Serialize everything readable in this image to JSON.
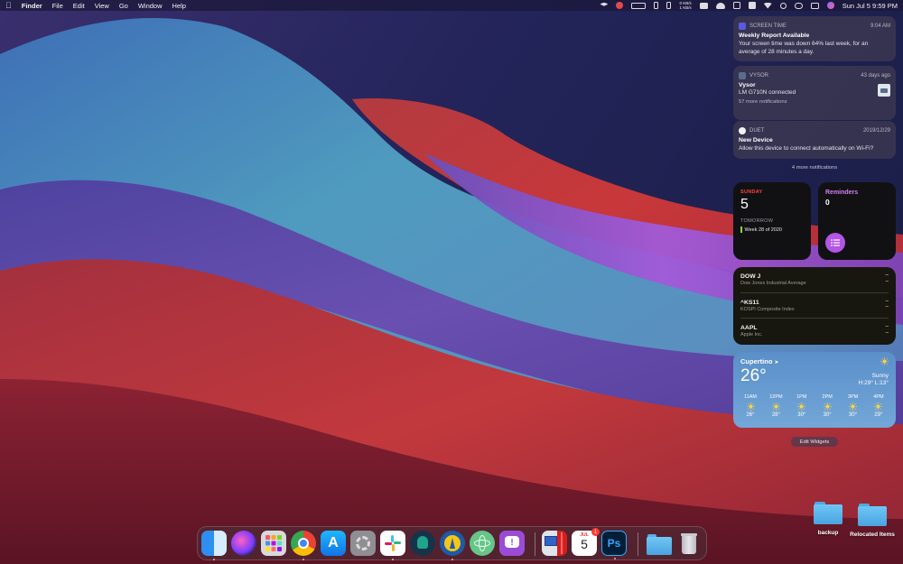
{
  "menubar": {
    "app_name": "Finder",
    "menus": [
      "File",
      "Edit",
      "View",
      "Go",
      "Window",
      "Help"
    ],
    "net_up": "0 KB/s",
    "net_down": "1 KB/s",
    "clock": "Sun Jul 5  9:59 PM",
    "status_icons": [
      "dropbox-icon",
      "avira-icon",
      "display-icon",
      "battery-icon",
      "memory-icon",
      "network-monitor-icon",
      "screen-mirror-icon",
      "cloud-icon",
      "vpn-icon",
      "keyboard-input-icon",
      "wifi-icon",
      "search-icon",
      "wechat-icon",
      "control-center-icon",
      "siri-icon"
    ]
  },
  "notifications": [
    {
      "app": "SCREEN TIME",
      "time": "9:04 AM",
      "title": "Weekly Report Available",
      "body": "Your screen time was down 64% last week, for an average of 28 minutes a day.",
      "icon_color": "#5a5adf"
    },
    {
      "app": "VYSOR",
      "time": "43 days ago",
      "title": "Vysor",
      "body": "LM G710N connected",
      "more": "57 more notifications",
      "icon_color": "#5a6e8c"
    },
    {
      "app": "DUET",
      "time": "2019/12/29",
      "title": "New Device",
      "body": "Allow this device to connect automatically on Wi-Fi?",
      "icon_color": "#f2f2f2"
    }
  ],
  "more_notifications": "4 more notifications",
  "calendar_widget": {
    "weekday": "SUNDAY",
    "date": "5",
    "tomorrow_label": "TOMORROW",
    "event": "Week 28 of 2020"
  },
  "reminders_widget": {
    "title": "Reminders",
    "count": "0"
  },
  "stocks_widget": {
    "rows": [
      {
        "symbol": "DOW J",
        "name": "Dow Jones Industrial Average",
        "value": "–",
        "change": "–"
      },
      {
        "symbol": "^KS11",
        "name": "KOSPI Composite Index",
        "value": "–",
        "change": "–"
      },
      {
        "symbol": "AAPL",
        "name": "Apple Inc.",
        "value": "–",
        "change": "–"
      }
    ]
  },
  "weather_widget": {
    "city": "Cupertino",
    "temp": "26°",
    "condition": "Sunny",
    "hilo": "H:29° L:13°",
    "hours": [
      {
        "time": "11AM",
        "temp": "26°"
      },
      {
        "time": "12PM",
        "temp": "28°"
      },
      {
        "time": "1PM",
        "temp": "30°"
      },
      {
        "time": "2PM",
        "temp": "30°"
      },
      {
        "time": "3PM",
        "temp": "30°"
      },
      {
        "time": "4PM",
        "temp": "29°"
      }
    ]
  },
  "edit_widgets_label": "Edit Widgets",
  "desktop_icons": [
    {
      "label": "backup"
    },
    {
      "label": "Relocated Items"
    }
  ],
  "dock": {
    "apps": [
      {
        "name": "finder-icon",
        "running": true
      },
      {
        "name": "siri-icon",
        "running": false
      },
      {
        "name": "launchpad-icon",
        "running": false
      },
      {
        "name": "chrome-icon",
        "running": true
      },
      {
        "name": "app-store-icon",
        "running": false
      },
      {
        "name": "system-preferences-icon",
        "running": false
      },
      {
        "name": "slack-icon",
        "running": true
      },
      {
        "name": "gitkraken-icon",
        "running": false
      },
      {
        "name": "android-studio-icon",
        "running": true
      },
      {
        "name": "atom-icon",
        "running": false
      },
      {
        "name": "feedback-assistant-icon",
        "running": false
      },
      {
        "name": "parallels-icon",
        "running": false
      },
      {
        "name": "calendar-icon",
        "running": false
      },
      {
        "name": "photoshop-icon",
        "running": true
      },
      {
        "name": "downloads-folder-icon",
        "running": false
      },
      {
        "name": "trash-icon",
        "running": false
      }
    ],
    "calendar_month": "JUL",
    "calendar_day": "5",
    "calendar_badge": "1",
    "photoshop_label": "Ps"
  }
}
